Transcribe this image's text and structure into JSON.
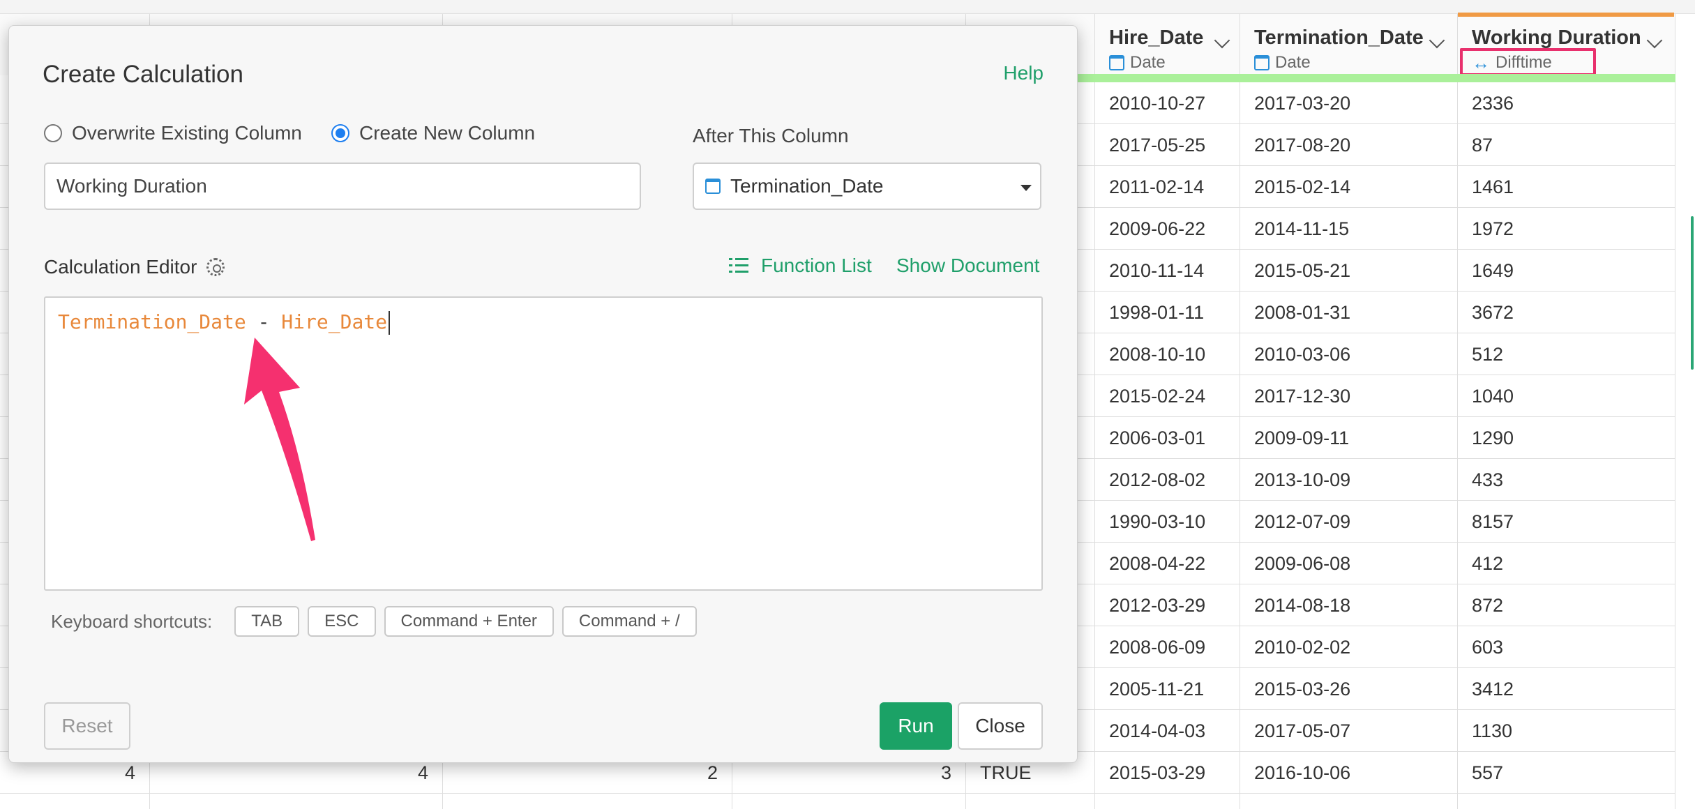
{
  "columns": {
    "hire_date": {
      "name": "Hire_Date",
      "type": "Date"
    },
    "termination_date": {
      "name": "Termination_Date",
      "type": "Date"
    },
    "working_duration": {
      "name": "Working Duration",
      "type": "Difftime"
    }
  },
  "rows": [
    {
      "hire": "2010-10-27",
      "term": "2017-03-20",
      "dur": "2336"
    },
    {
      "hire": "2017-05-25",
      "term": "2017-08-20",
      "dur": "87"
    },
    {
      "hire": "2011-02-14",
      "term": "2015-02-14",
      "dur": "1461"
    },
    {
      "hire": "2009-06-22",
      "term": "2014-11-15",
      "dur": "1972"
    },
    {
      "hire": "2010-11-14",
      "term": "2015-05-21",
      "dur": "1649"
    },
    {
      "hire": "1998-01-11",
      "term": "2008-01-31",
      "dur": "3672"
    },
    {
      "hire": "2008-10-10",
      "term": "2010-03-06",
      "dur": "512"
    },
    {
      "hire": "2015-02-24",
      "term": "2017-12-30",
      "dur": "1040"
    },
    {
      "hire": "2006-03-01",
      "term": "2009-09-11",
      "dur": "1290"
    },
    {
      "hire": "2012-08-02",
      "term": "2013-10-09",
      "dur": "433"
    },
    {
      "hire": "1990-03-10",
      "term": "2012-07-09",
      "dur": "8157"
    },
    {
      "hire": "2008-04-22",
      "term": "2009-06-08",
      "dur": "412"
    },
    {
      "hire": "2012-03-29",
      "term": "2014-08-18",
      "dur": "872"
    },
    {
      "hire": "2008-06-09",
      "term": "2010-02-02",
      "dur": "603"
    },
    {
      "hire": "2005-11-21",
      "term": "2015-03-26",
      "dur": "3412"
    },
    {
      "hire": "2014-04-03",
      "term": "2017-05-07",
      "dur": "1130"
    }
  ],
  "bottom_row": {
    "c1": "4",
    "c2": "4",
    "c3": "2",
    "c4": "3",
    "c5": "TRUE",
    "hire": "2015-03-29",
    "term": "2016-10-06",
    "dur": "557"
  },
  "modal": {
    "title": "Create Calculation",
    "help": "Help",
    "radio_overwrite": "Overwrite Existing Column",
    "radio_create": "Create New Column",
    "after_label": "After This Column",
    "column_name_value": "Working Duration",
    "after_select_value": "Termination_Date",
    "editor_label": "Calculation Editor",
    "function_list": "Function List",
    "show_document": "Show Document",
    "code_left": "Termination_Date",
    "code_op": " - ",
    "code_right": "Hire_Date",
    "shortcuts_label": "Keyboard shortcuts:",
    "shortcuts": [
      "TAB",
      "ESC",
      "Command + Enter",
      "Command + /"
    ],
    "reset": "Reset",
    "run": "Run",
    "close": "Close"
  },
  "colors": {
    "accent": "#1ba266",
    "highlight": "#e8306d",
    "arrow": "#f5306f",
    "code": "#e8883a"
  }
}
